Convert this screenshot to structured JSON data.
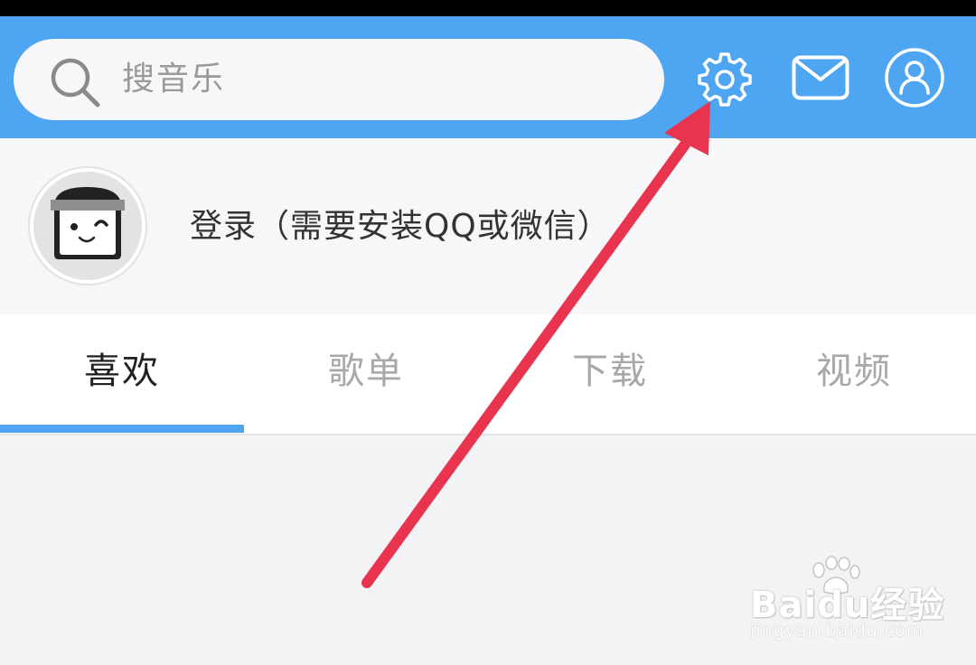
{
  "search": {
    "placeholder": "搜音乐"
  },
  "header": {
    "icons": [
      "search-icon",
      "gear-icon",
      "mail-icon",
      "user-icon"
    ]
  },
  "profile": {
    "login_text": "登录（需要安装QQ或微信）"
  },
  "tabs": [
    {
      "label": "喜欢",
      "active": true
    },
    {
      "label": "歌单",
      "active": false
    },
    {
      "label": "下载",
      "active": false
    },
    {
      "label": "视频",
      "active": false
    }
  ],
  "watermark": {
    "brand": "Baidu经验",
    "url": "jingyan.baidu.com"
  },
  "colors": {
    "header": "#4ea6f2",
    "accent": "#4ea6f2",
    "annotation_arrow": "#e8344e"
  }
}
